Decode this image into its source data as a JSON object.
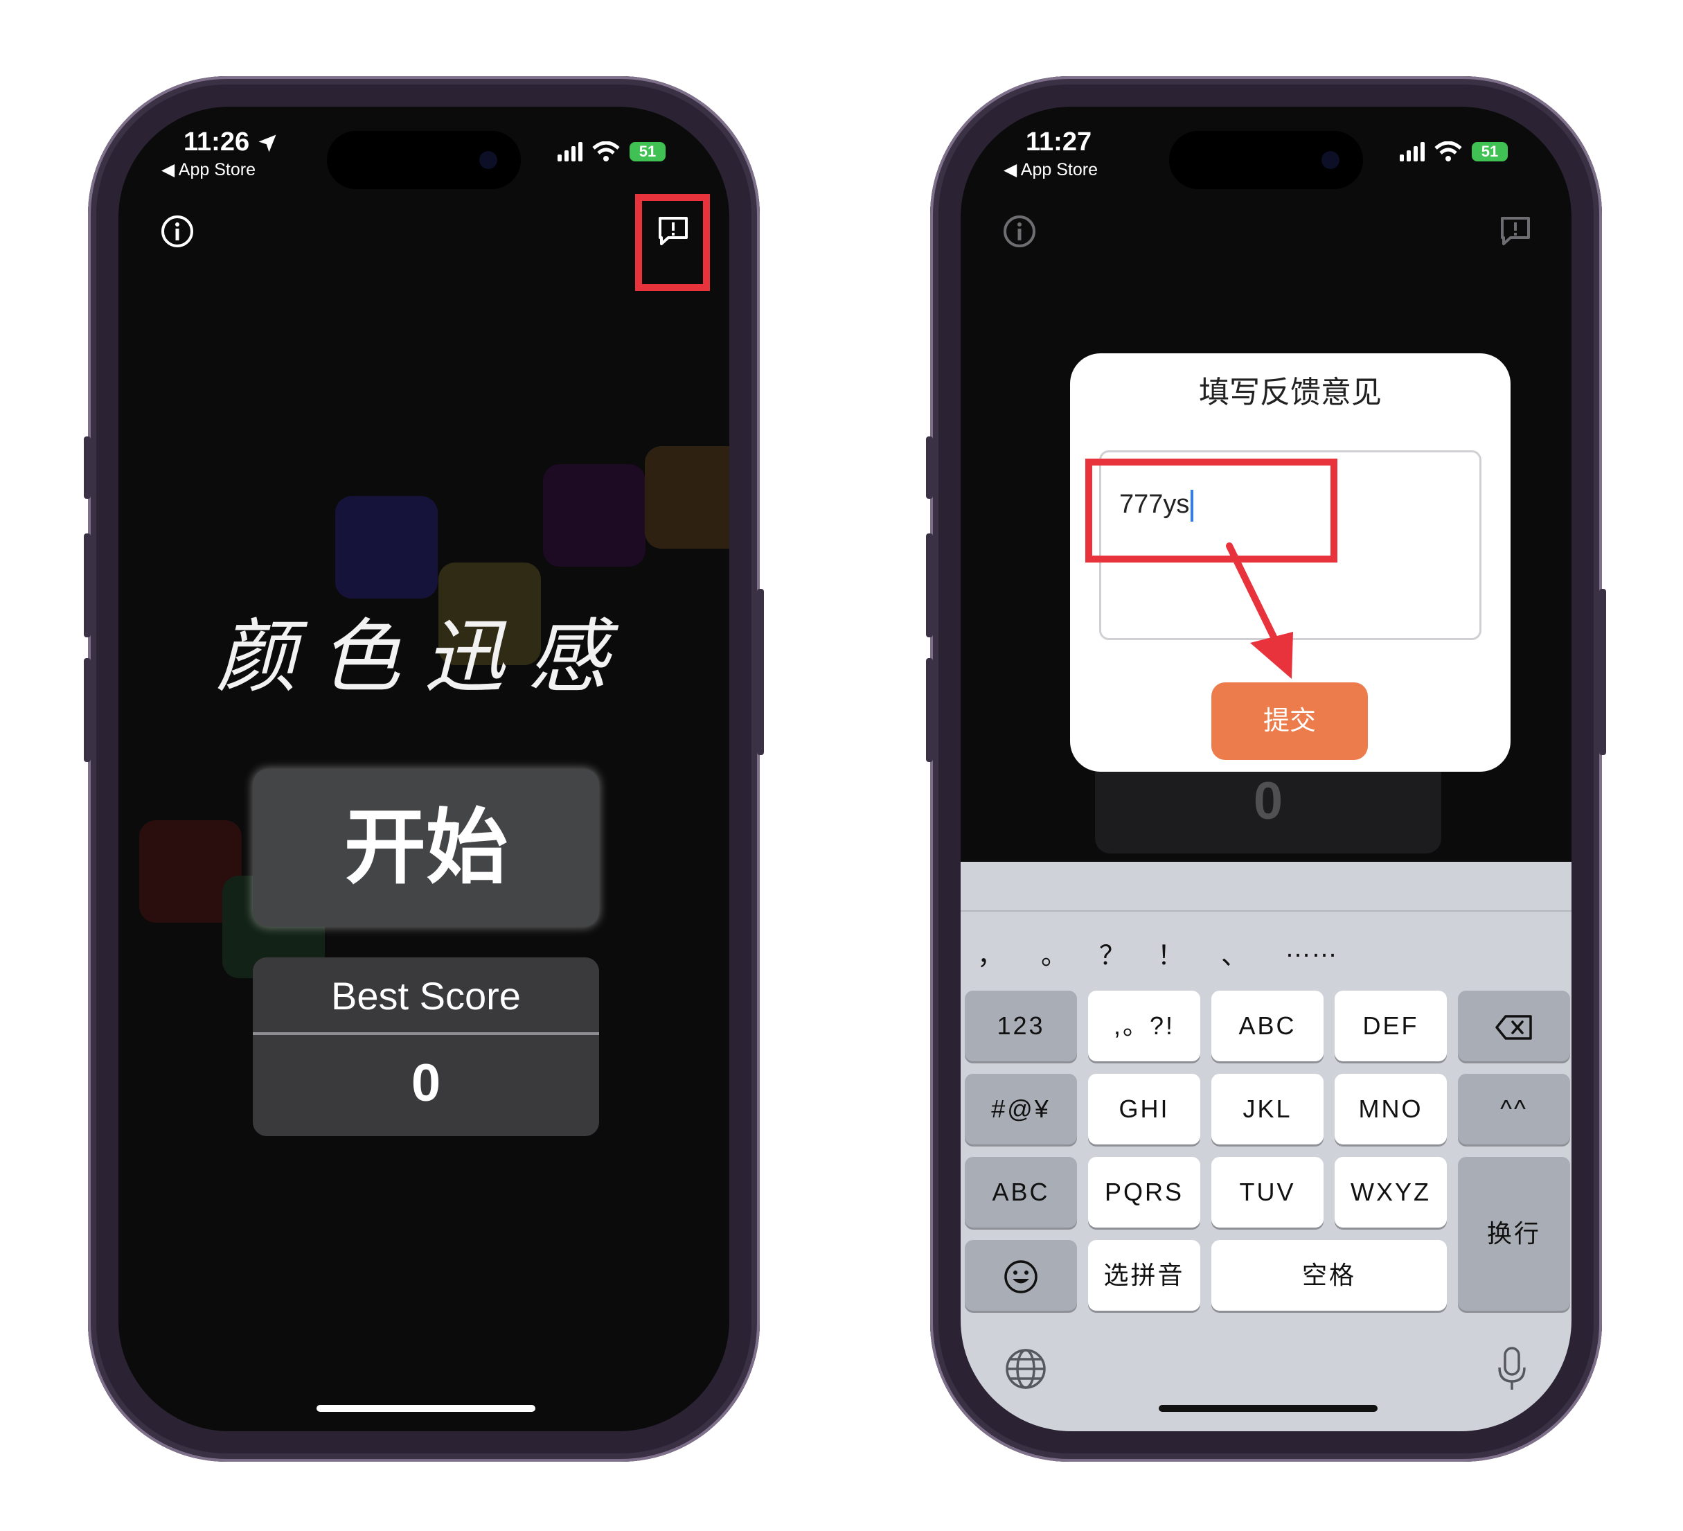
{
  "left_phone": {
    "status": {
      "time": "11:26",
      "back_label": "App Store",
      "battery": "51"
    },
    "title": "颜色迅感",
    "start_label": "开始",
    "best_score_label": "Best Score",
    "best_score_value": "0"
  },
  "right_phone": {
    "status": {
      "time": "11:27",
      "back_label": "App Store",
      "battery": "51"
    },
    "dialog": {
      "title": "填写反馈意见",
      "input_value": "777ys",
      "submit_label": "提交"
    },
    "background_score": "0",
    "keyboard": {
      "candidates": [
        "，",
        "。",
        "？",
        "！",
        "、",
        "……"
      ],
      "rows": [
        [
          "123",
          ",。?!",
          "ABC",
          "DEF"
        ],
        [
          "#@¥",
          "GHI",
          "JKL",
          "MNO",
          "^^"
        ],
        [
          "ABC",
          "PQRS",
          "TUV",
          "WXYZ"
        ],
        [
          "选拼音",
          "空格"
        ]
      ],
      "return_label": "换行"
    }
  },
  "colors": {
    "highlight": "#e8333c",
    "submit": "#ec7c4b",
    "battery": "#3fc153"
  }
}
